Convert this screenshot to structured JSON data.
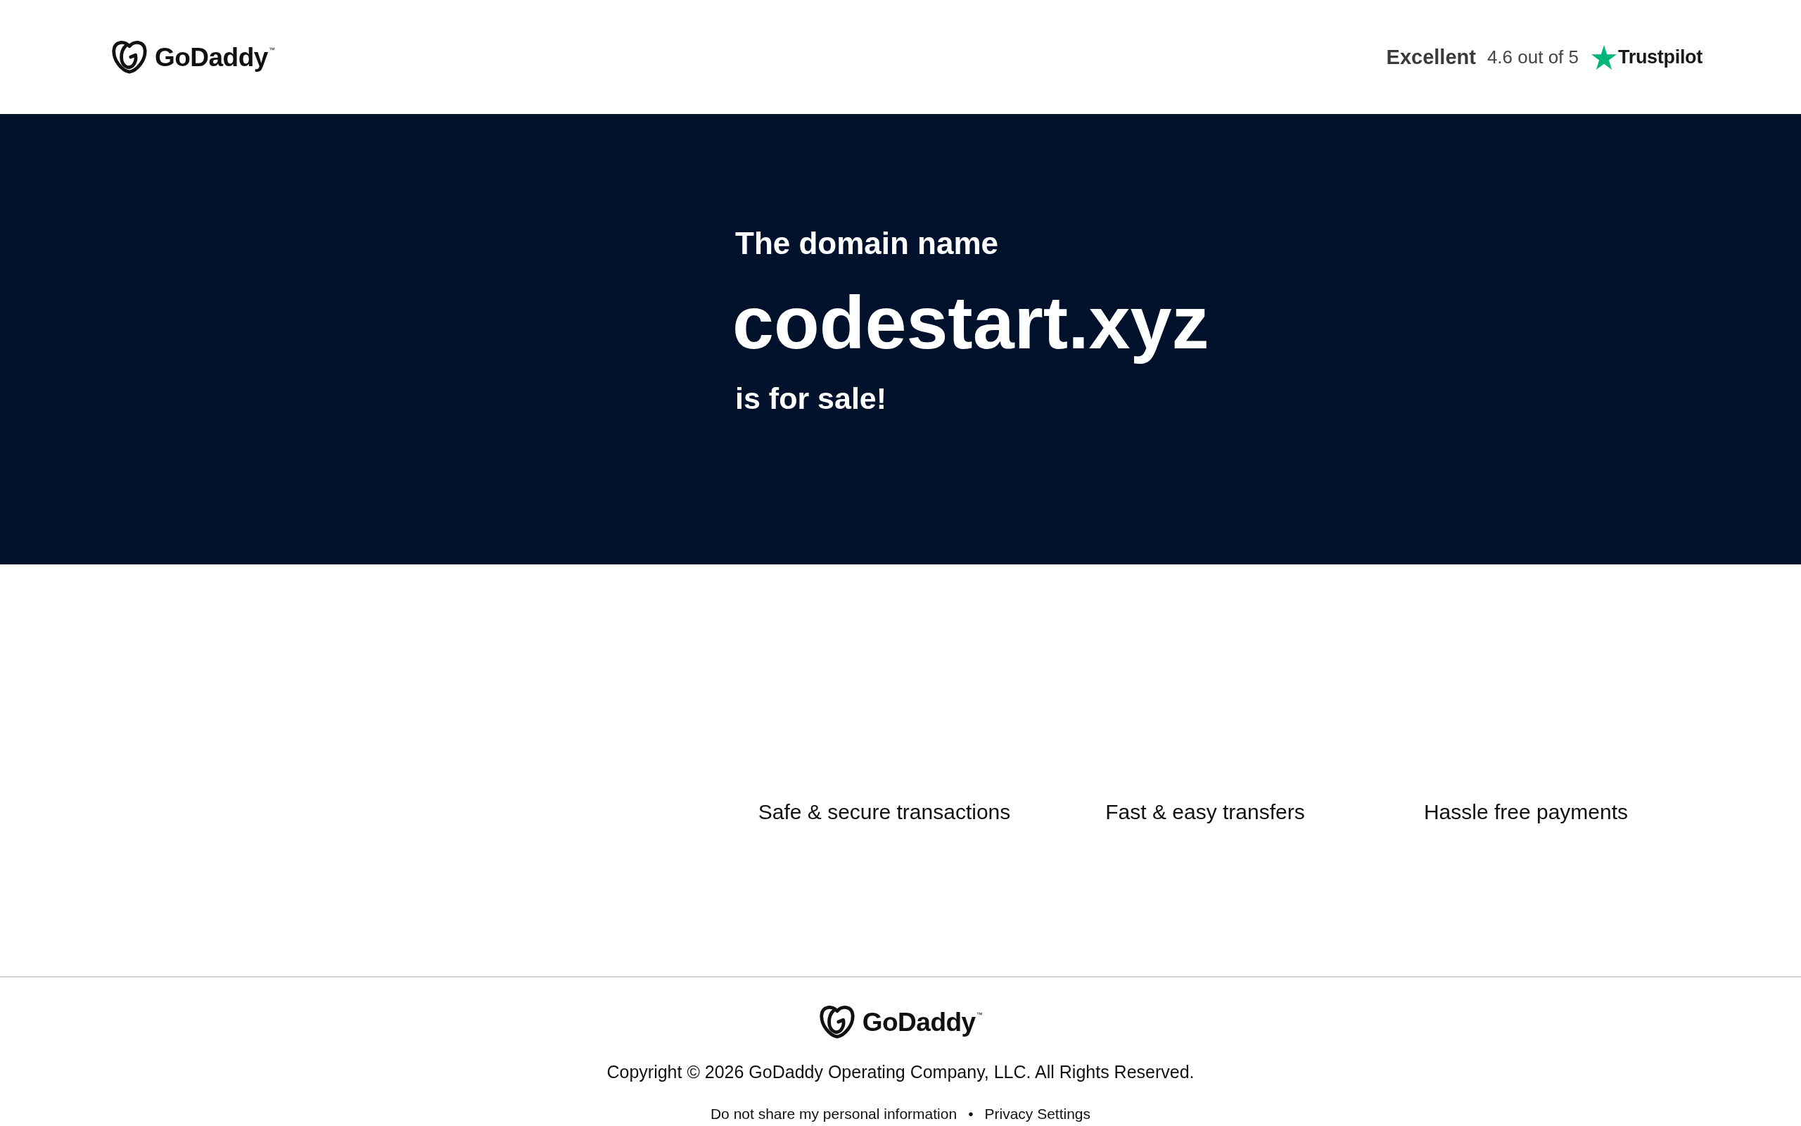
{
  "header": {
    "logo": {
      "wordmark": "GoDaddy",
      "trademark": "™"
    },
    "rating": {
      "label": "Excellent",
      "score": "4.6 out of 5",
      "brand": "Trustpilot"
    }
  },
  "hero": {
    "intro": "The domain name",
    "domain": "codestart.xyz",
    "outro": "is for sale!"
  },
  "features": [
    "Safe & secure transactions",
    "Fast & easy transfers",
    "Hassle free payments"
  ],
  "footer": {
    "logo": {
      "wordmark": "GoDaddy",
      "trademark": "™"
    },
    "copyright": "Copyright © 2026 GoDaddy Operating Company, LLC. All Rights Reserved.",
    "links": [
      "Do not share my personal information",
      "Privacy Settings"
    ],
    "separator": "•"
  }
}
